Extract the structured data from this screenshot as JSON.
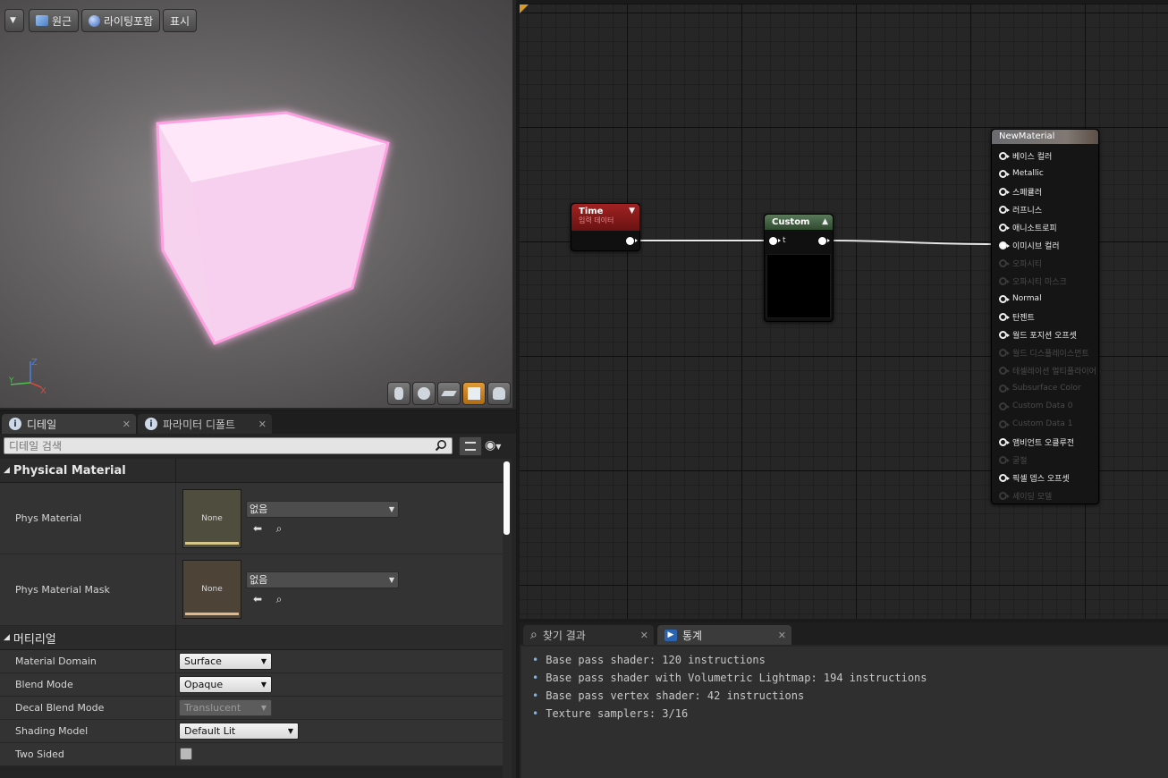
{
  "viewport": {
    "toolbar": {
      "menu_icon": "chevron-down-icon",
      "perspective_label": "원근",
      "lighting_label": "라이팅포함",
      "show_label": "표시"
    },
    "axis": {
      "z": "Z",
      "y": "Y",
      "x": "X"
    },
    "preview_shapes": [
      "cylinder-icon",
      "sphere-icon",
      "plane-icon",
      "cube-icon",
      "custom-mesh-icon"
    ],
    "active_shape": "cube-icon",
    "cube_glow_color": "#ff9ee0"
  },
  "details": {
    "tabs": [
      {
        "label": "디테일",
        "icon": "info-icon",
        "active": true
      },
      {
        "label": "파라미터 디폴트",
        "icon": "info-icon",
        "active": false
      }
    ],
    "search_placeholder": "디테일 검색",
    "categories": {
      "physical": {
        "title": "Physical Material",
        "rows": [
          {
            "name": "Phys Material",
            "thumb": "None",
            "value": "없음"
          },
          {
            "name": "Phys Material Mask",
            "thumb": "None",
            "value": "없음"
          }
        ]
      },
      "material": {
        "title": "머티리얼",
        "rows": [
          {
            "name": "Material Domain",
            "value": "Surface"
          },
          {
            "name": "Blend Mode",
            "value": "Opaque"
          },
          {
            "name": "Decal Blend Mode",
            "value": "Translucent"
          },
          {
            "name": "Shading Model",
            "value": "Default Lit"
          },
          {
            "name": "Two Sided",
            "value": ""
          }
        ]
      }
    }
  },
  "graph": {
    "time_node": {
      "title": "Time",
      "subtitle": "입력 데이터",
      "color": "#8b1a1a"
    },
    "custom_node": {
      "title": "Custom",
      "input_label": "t",
      "color": "#3e5a3e"
    },
    "material_node": {
      "title": "NewMaterial",
      "pins": [
        {
          "label": "베이스 컬러",
          "enabled": true,
          "connected": false
        },
        {
          "label": "Metallic",
          "enabled": true,
          "connected": false
        },
        {
          "label": "스페큘러",
          "enabled": true,
          "connected": false
        },
        {
          "label": "러프니스",
          "enabled": true,
          "connected": false
        },
        {
          "label": "애니소트로피",
          "enabled": true,
          "connected": false
        },
        {
          "label": "이미시브 컬러",
          "enabled": true,
          "connected": true
        },
        {
          "label": "오파시티",
          "enabled": false,
          "connected": false
        },
        {
          "label": "오파시티 마스크",
          "enabled": false,
          "connected": false
        },
        {
          "label": "Normal",
          "enabled": true,
          "connected": false
        },
        {
          "label": "탄젠트",
          "enabled": true,
          "connected": false
        },
        {
          "label": "월드 포지션 오프셋",
          "enabled": true,
          "connected": false
        },
        {
          "label": "월드 디스플레이스먼트",
          "enabled": false,
          "connected": false
        },
        {
          "label": "테셀레이션 멀티플라이어",
          "enabled": false,
          "connected": false
        },
        {
          "label": "Subsurface Color",
          "enabled": false,
          "connected": false
        },
        {
          "label": "Custom Data 0",
          "enabled": false,
          "connected": false
        },
        {
          "label": "Custom Data 1",
          "enabled": false,
          "connected": false
        },
        {
          "label": "앰비언트 오클루전",
          "enabled": true,
          "connected": false
        },
        {
          "label": "굴절",
          "enabled": false,
          "connected": false
        },
        {
          "label": "픽셀 뎁스 오프셋",
          "enabled": true,
          "connected": false
        },
        {
          "label": "셰이딩 모델",
          "enabled": false,
          "connected": false
        }
      ]
    }
  },
  "stats": {
    "tabs": [
      {
        "label": "찾기 결과",
        "icon": "search-icon",
        "active": false
      },
      {
        "label": "통계",
        "icon": "stats-icon",
        "active": true
      }
    ],
    "lines": [
      "Base pass shader: 120 instructions",
      "Base pass shader with Volumetric Lightmap: 194 instructions",
      "Base pass vertex shader: 42 instructions",
      "Texture samplers: 3/16"
    ]
  }
}
